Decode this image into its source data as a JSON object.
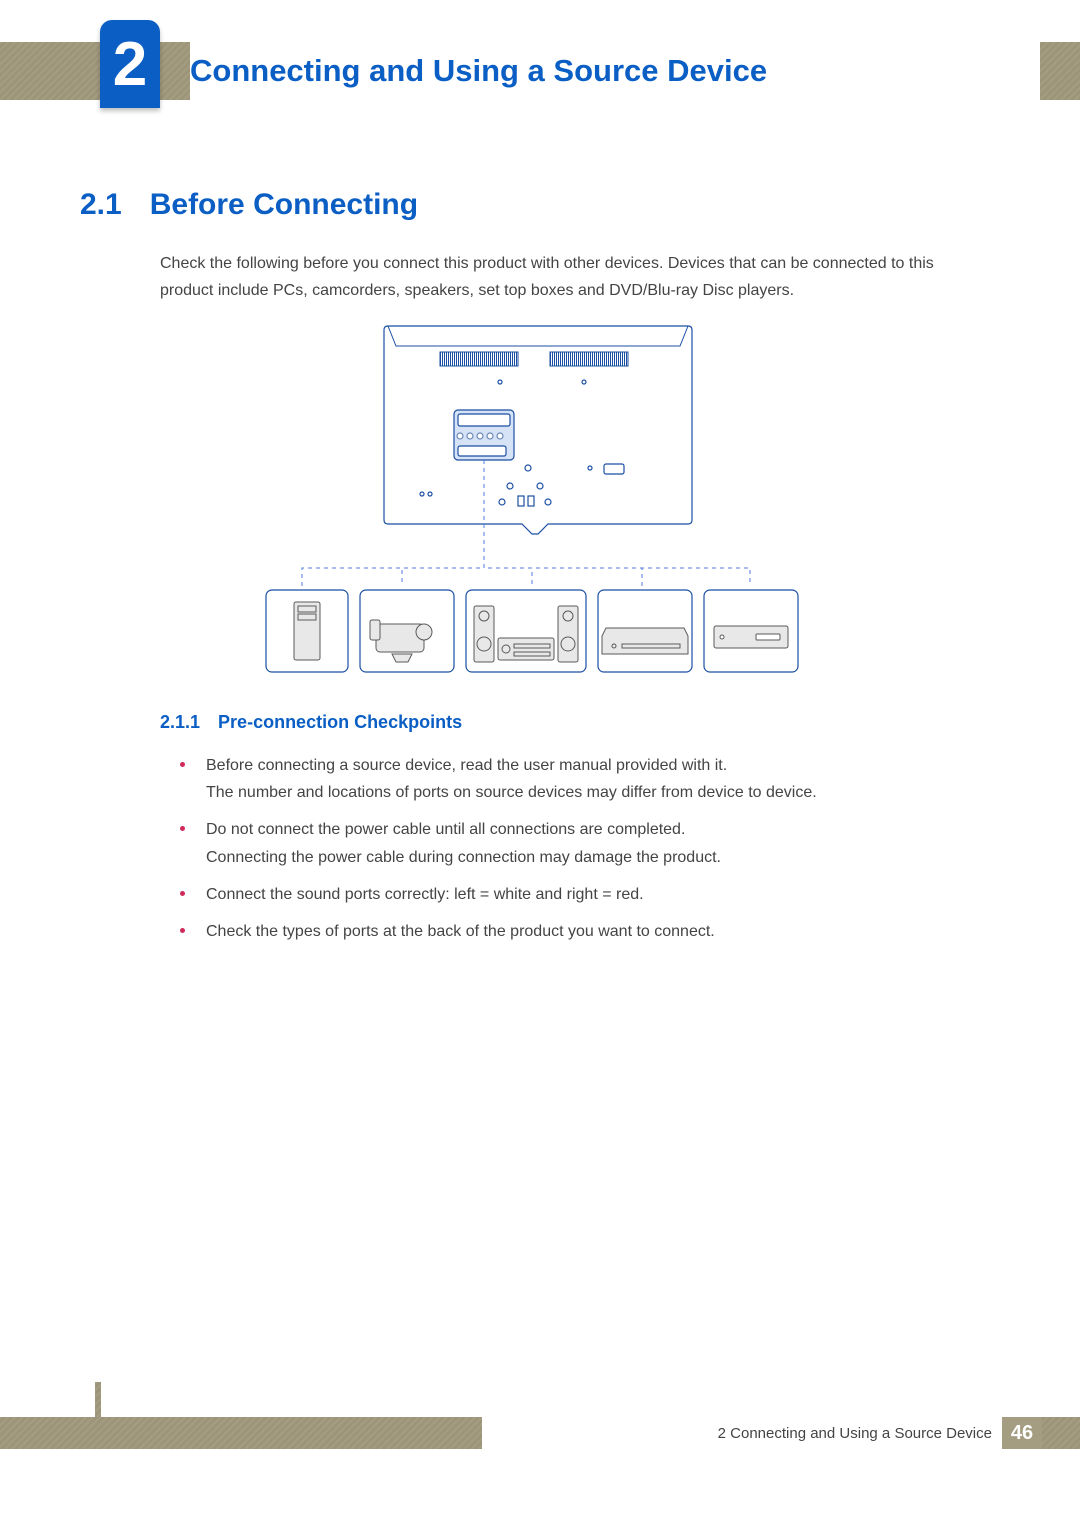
{
  "chapter": {
    "number": "2",
    "title": "Connecting and Using a Source Device"
  },
  "section": {
    "number": "2.1",
    "title": "Before Connecting",
    "intro": "Check the following before you connect this product with other devices. Devices that can be connected to this product include PCs, camcorders, speakers, set top boxes and DVD/Blu-ray Disc players."
  },
  "subsection": {
    "number": "2.1.1",
    "title": "Pre-connection Checkpoints"
  },
  "bullets": [
    "Before connecting a source device, read the user manual provided with it.\nThe number and locations of ports on source devices may differ from device to device.",
    "Do not connect the power cable until all connections are completed.\nConnecting the power cable during connection may damage the product.",
    "Connect the sound ports correctly: left = white and right = red.",
    "Check the types of ports at the back of the product you want to connect."
  ],
  "footer": {
    "chapter_ref": "2 Connecting and Using a Source Device",
    "page_number": "46"
  },
  "illustration": {
    "devices": [
      "pc-tower",
      "camcorder",
      "speaker-system",
      "set-top-box",
      "dvd-player"
    ]
  }
}
